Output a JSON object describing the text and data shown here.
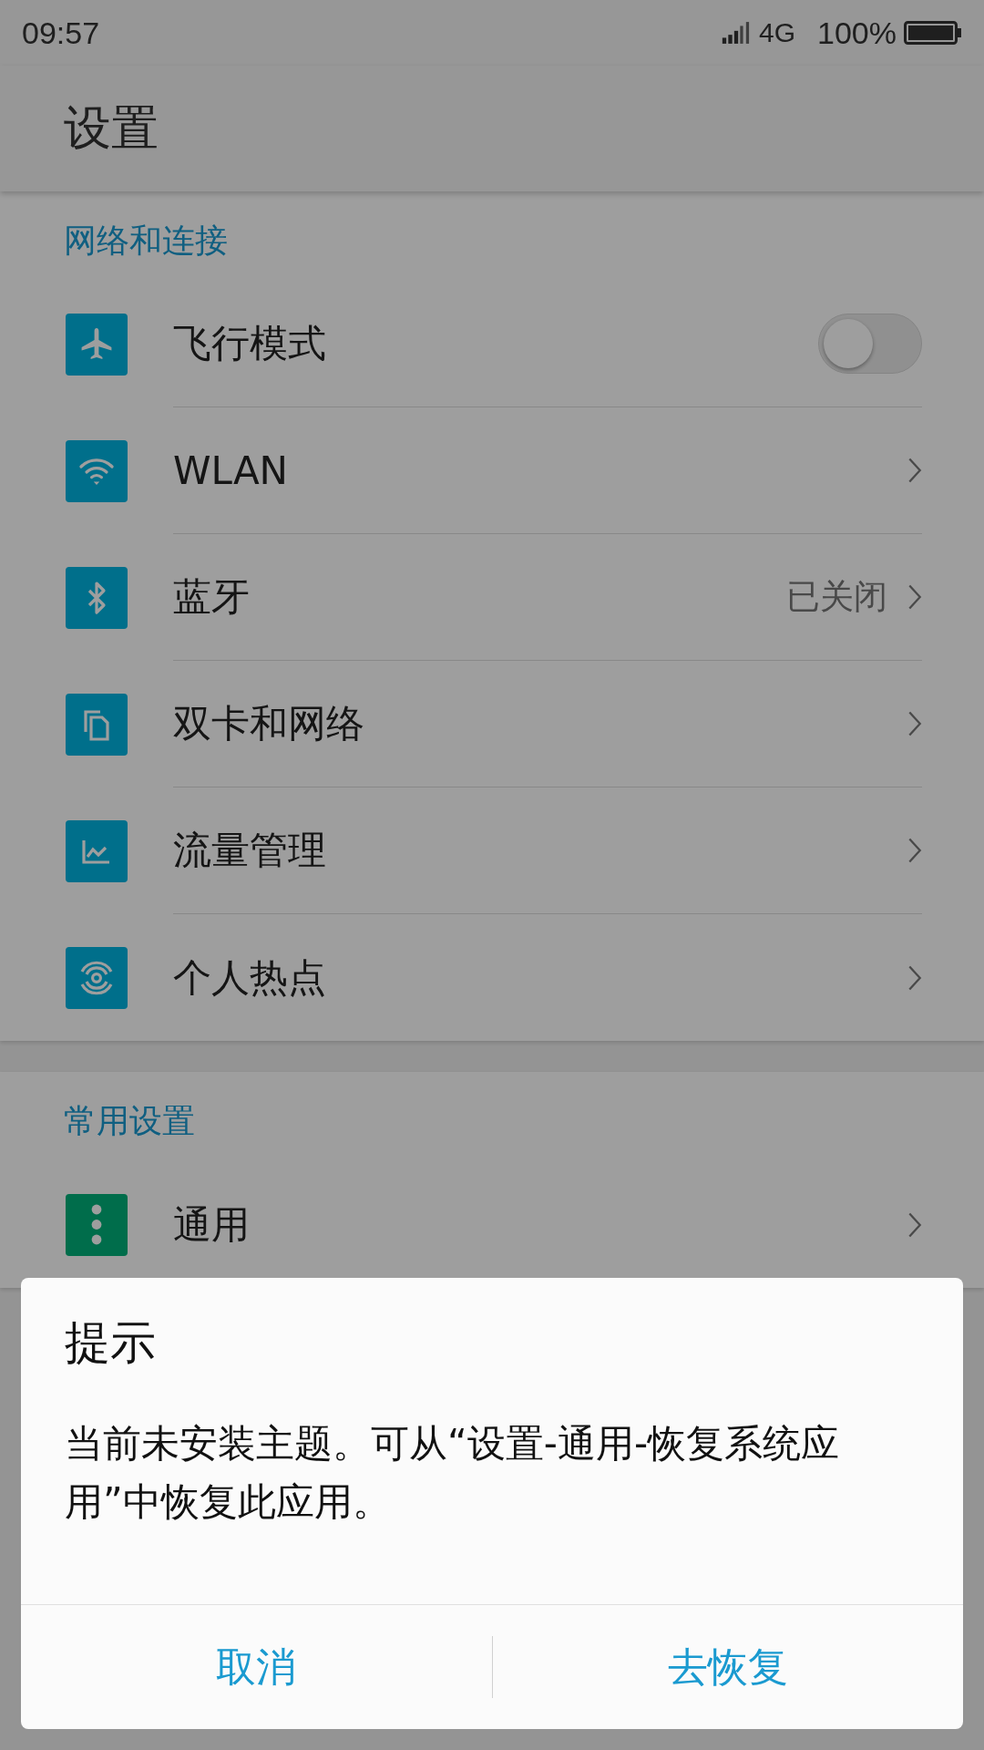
{
  "status_bar": {
    "time": "09:57",
    "network": "4G",
    "battery": "100%"
  },
  "app_bar": {
    "title": "设置"
  },
  "sections": [
    {
      "header": "网络和连接",
      "rows": [
        {
          "kind": "switch",
          "label": "飞行模式",
          "on": false
        },
        {
          "kind": "link",
          "label": "WLAN"
        },
        {
          "kind": "link",
          "label": "蓝牙",
          "value": "已关闭"
        },
        {
          "kind": "link",
          "label": "双卡和网络"
        },
        {
          "kind": "link",
          "label": "流量管理"
        },
        {
          "kind": "link",
          "label": "个人热点"
        }
      ]
    },
    {
      "header": "常用设置",
      "rows": [
        {
          "kind": "link",
          "label": "通用"
        }
      ]
    }
  ],
  "dialog": {
    "title": "提示",
    "message": "当前未安装主题。可从“设置-通用-恢复系统应用”中恢复此应用。",
    "buttons": [
      "取消",
      "去恢复"
    ]
  }
}
